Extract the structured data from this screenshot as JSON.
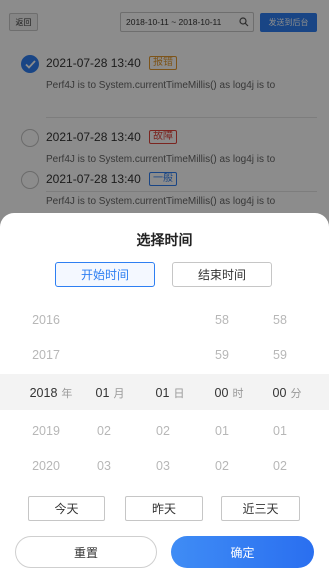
{
  "toolbar": {
    "back_label": "返回",
    "date_range": "2018-10-11 ~ 2018-10-11",
    "send_label": "发送到后台"
  },
  "records": [
    {
      "time": "2021-07-28 13:40",
      "tag": "报错",
      "tag_color": "#e39a2f",
      "description": "Perf4J is to System.currentTimeMillis() as log4j is to",
      "checked": true
    },
    {
      "time": "2021-07-28 13:40",
      "tag": "故障",
      "tag_color": "#e0443b",
      "description": "Perf4J is to System.currentTimeMillis() as log4j is to",
      "checked": false
    },
    {
      "time": "2021-07-28 13:40",
      "tag": "一般",
      "tag_color": "#2e7ff2",
      "description": "Perf4J is to System.currentTimeMillis() as log4j is to",
      "checked": false
    }
  ],
  "sheet": {
    "title": "选择时间",
    "tab_start": "开始时间",
    "tab_end": "结束时间"
  },
  "picker": {
    "year": {
      "above": [
        "2016",
        "2017"
      ],
      "selected": "2018",
      "unit": "年",
      "below": [
        "2019",
        "2020"
      ]
    },
    "month": {
      "above": [
        "",
        ""
      ],
      "selected": "01",
      "unit": "月",
      "below": [
        "02",
        "03"
      ]
    },
    "day": {
      "above": [
        "",
        ""
      ],
      "selected": "01",
      "unit": "日",
      "below": [
        "02",
        "03"
      ]
    },
    "hour": {
      "above": [
        "58",
        "59"
      ],
      "selected": "00",
      "unit": "时",
      "below": [
        "01",
        "02"
      ]
    },
    "minute": {
      "above": [
        "58",
        "59"
      ],
      "selected": "00",
      "unit": "分",
      "below": [
        "01",
        "02"
      ]
    }
  },
  "quick": {
    "today": "今天",
    "yesterday": "昨天",
    "last_three_days": "近三天"
  },
  "actions": {
    "reset": "重置",
    "confirm": "确定"
  },
  "colors": {
    "accent": "#2e7ff2"
  }
}
